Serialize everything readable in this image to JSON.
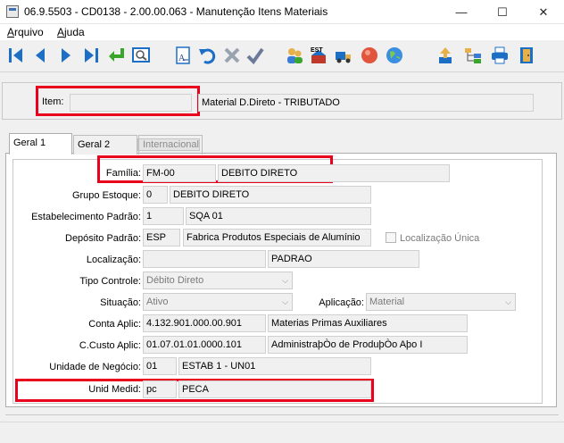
{
  "window": {
    "title": "06.9.5503 - CD0138 - 2.00.00.063 - Manutenção Itens Materiais",
    "minimize_label": "—",
    "maximize_label": "☐",
    "close_label": "✕"
  },
  "menu": {
    "arquivo_first": "A",
    "arquivo_rest": "rquivo",
    "ajuda_first": "A",
    "ajuda_rest": "juda"
  },
  "toolbar": {
    "buttons": [
      "first-record",
      "previous-record",
      "next-record",
      "last-record",
      "go-to",
      "search",
      "edit",
      "undo",
      "delete",
      "confirm",
      "users",
      "est",
      "truck",
      "stop",
      "globe",
      "upload",
      "tree",
      "print",
      "exit"
    ],
    "est_label": "EST"
  },
  "header": {
    "item_label": "Item:",
    "item_value": "",
    "description": "Material D.Direto - TRIBUTADO"
  },
  "tabs": [
    {
      "label": "Geral 1",
      "active": true,
      "enabled": true
    },
    {
      "label": "Geral 2",
      "active": false,
      "enabled": true
    },
    {
      "label": "Internacional",
      "active": false,
      "enabled": false
    }
  ],
  "form": {
    "familia": {
      "label": "Família:",
      "code": "FM-00",
      "desc": "DEBITO DIRETO"
    },
    "grupo_estoque": {
      "label": "Grupo Estoque:",
      "code": "0",
      "desc": "DEBITO DIRETO"
    },
    "estabelecimento": {
      "label": "Estabelecimento Padrão:",
      "code": "1",
      "desc": "SQA 01"
    },
    "deposito": {
      "label": "Depósito Padrão:",
      "code": "ESP",
      "desc": "Fabrica Produtos Especiais de Alumínio"
    },
    "localizacao_unica": {
      "label": "Localização Única",
      "checked": false
    },
    "localizacao": {
      "label": "Localização:",
      "code": "",
      "desc": "PADRAO"
    },
    "tipo_controle": {
      "label": "Tipo Controle:",
      "value": "Débito Direto"
    },
    "situacao": {
      "label": "Situação:",
      "value": "Ativo"
    },
    "aplicacao": {
      "label": "Aplicação:",
      "value": "Material"
    },
    "conta_aplic": {
      "label": "Conta Aplic:",
      "code": "4.132.901.000.00.901",
      "desc": "Materias Primas Auxiliares"
    },
    "ccusto_aplic": {
      "label": "C.Custo Aplic:",
      "code": "01.07.01.01.0000.101",
      "desc": "AdministraþÒo de ProduþÒo Aþo I"
    },
    "unidade_negocio": {
      "label": "Unidade de Negócio:",
      "code": "01",
      "desc": "ESTAB 1 - UN01"
    },
    "unid_medid": {
      "label": "Unid Medid:",
      "code": "pc",
      "desc": "PECA"
    }
  },
  "colors": {
    "highlight": "#e8001c",
    "toolbar_blue": "#1d6fc5"
  }
}
